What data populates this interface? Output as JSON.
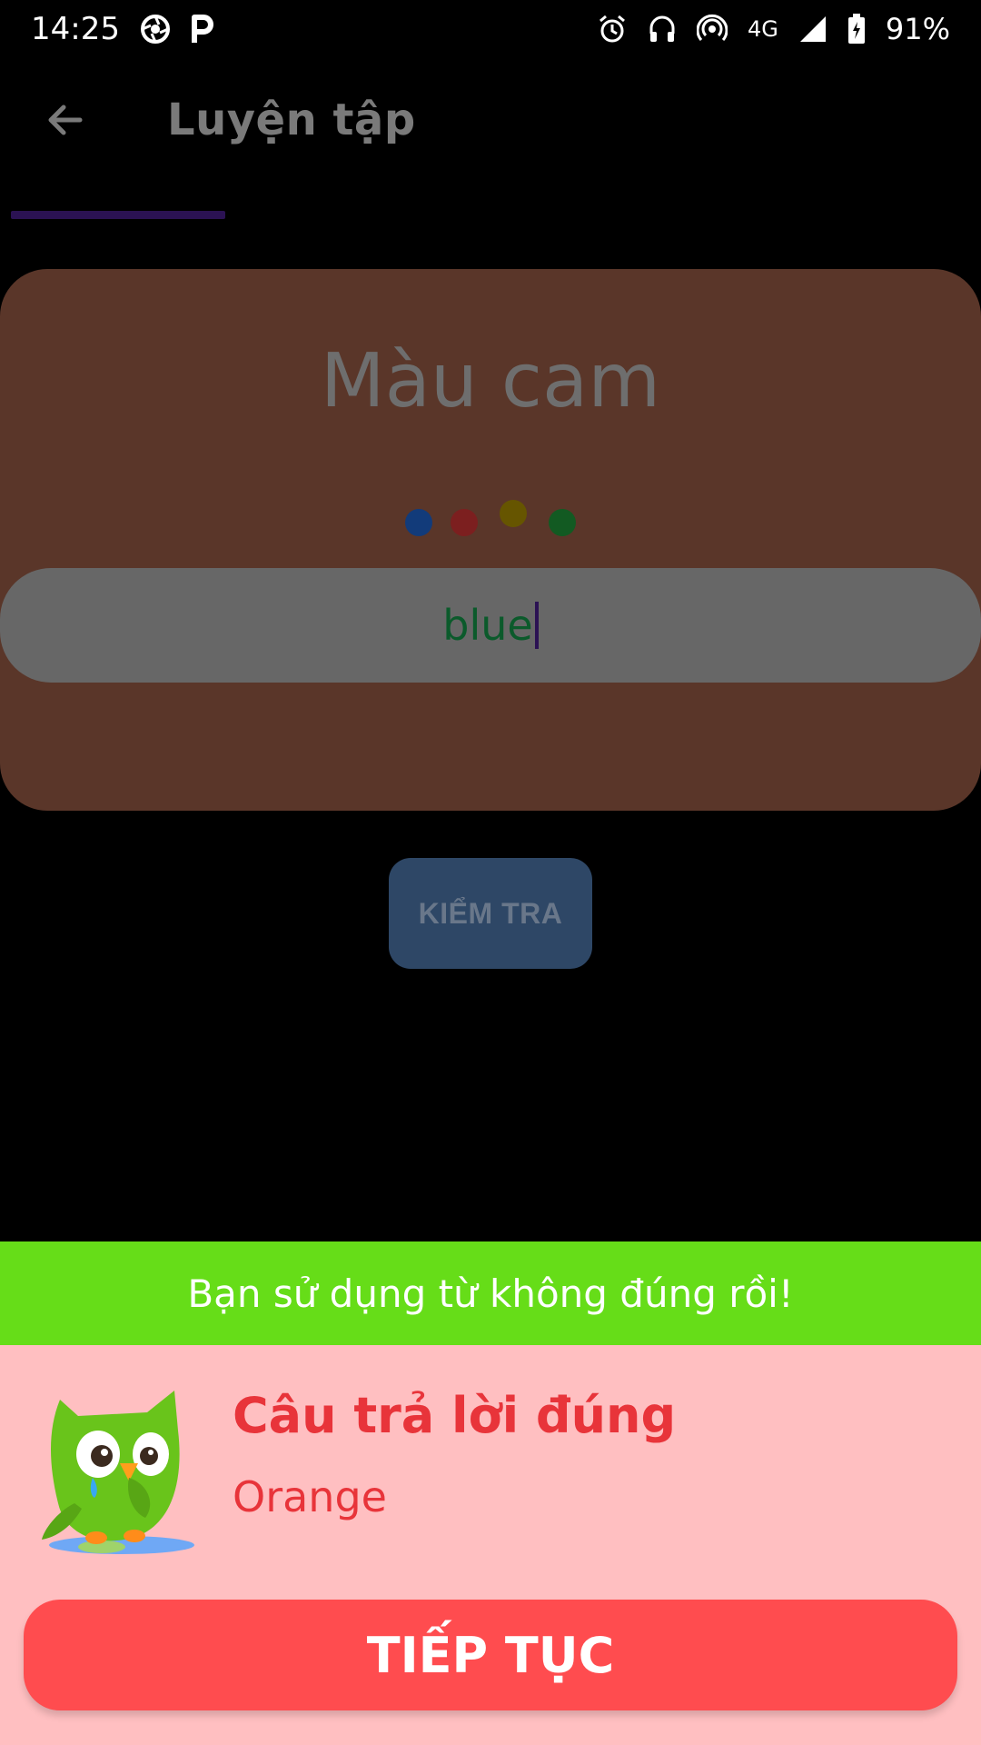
{
  "status_bar": {
    "time": "14:25",
    "network": "4G",
    "battery": "91%",
    "icons": [
      "aperture-icon",
      "p-icon",
      "alarm-icon",
      "headset-icon",
      "hotspot-icon",
      "signal-icon",
      "battery-icon"
    ]
  },
  "app_bar": {
    "title": "Luyện tập",
    "back_icon": "arrow-left-icon"
  },
  "progress": {
    "value": 0.22,
    "color": "#2b1253"
  },
  "card": {
    "question_word": "Màu cam",
    "dot_colors": [
      "#123b7a",
      "#7c1f1f",
      "#665500",
      "#125a22"
    ],
    "answer_value": "blue"
  },
  "check_button": {
    "label": "KIỂM TRA"
  },
  "feedback": {
    "banner_text": "Bạn sử dụng từ không đúng rồi!",
    "correct_title": "Câu trả lời đúng",
    "correct_answer": "Orange",
    "continue_label": "TIẾP TỤC"
  },
  "colors": {
    "banner": "#66dd18",
    "sheet": "#ffbfc1",
    "error_text": "#e8343a",
    "continue_button": "#ff4c4f",
    "card": "#5a3629"
  }
}
